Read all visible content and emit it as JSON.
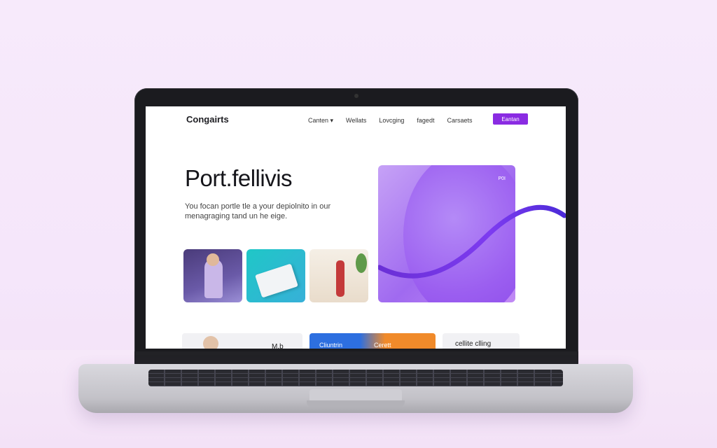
{
  "site": {
    "logo": "Congairts",
    "nav": [
      {
        "label": "Canten ▾"
      },
      {
        "label": "Wellats"
      },
      {
        "label": "Lovcging"
      },
      {
        "label": "fagedt"
      },
      {
        "label": "Carsaets"
      }
    ],
    "cta_label": "Eantan"
  },
  "hero": {
    "title": "Port.fellivis",
    "description": "You focan portle tle a your depiolnito in our menagraging tand un he eige.",
    "art_tag": "P0I",
    "accent_color": "#8a2be2"
  },
  "bottom_cards": {
    "card1_text": "M.b",
    "card2_left": "Cliuntrin",
    "card2_right": "Cerett",
    "card3_text": "cellite clling"
  }
}
